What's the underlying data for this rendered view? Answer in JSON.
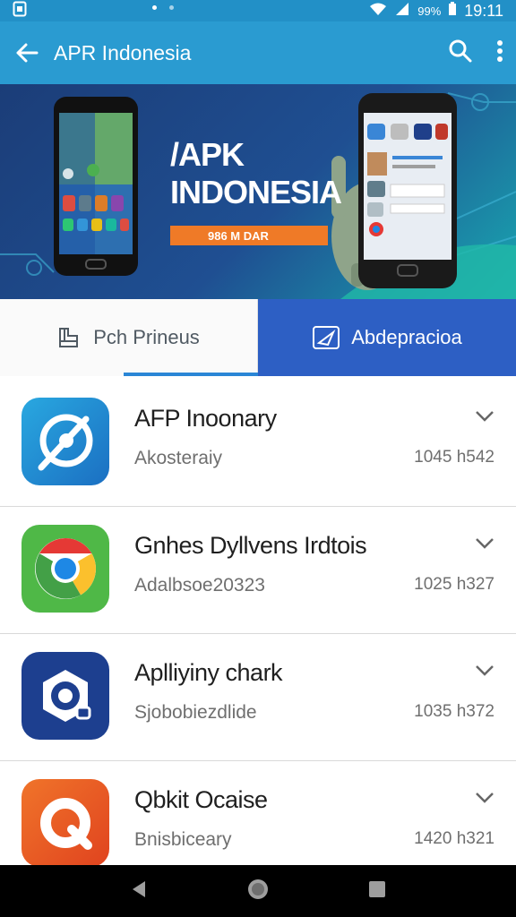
{
  "status_bar": {
    "time": "19:11",
    "battery": "99%"
  },
  "app_bar": {
    "title": "APR Indonesia"
  },
  "banner": {
    "title_line1": "/APK",
    "title_line2": "INDONESIA",
    "tagline": "986 M DAR"
  },
  "tabs": [
    {
      "label": "Pch Prineus",
      "icon": "store-icon"
    },
    {
      "label": "Abdepracioa",
      "icon": "send-icon"
    }
  ],
  "apps": [
    {
      "title": "AFP Inoonary",
      "subtitle": "Akosteraiy",
      "meta": "1045 h542",
      "icon": "compass-app-icon"
    },
    {
      "title": "Gnhes Dyllvens Irdtois",
      "subtitle": "Adalbsoe20323",
      "meta": "1025 h327",
      "icon": "chrome-app-icon"
    },
    {
      "title": "Aplliyiny chark",
      "subtitle": "Sjobobiezdlide",
      "meta": "1035 h372",
      "icon": "camera-app-icon"
    },
    {
      "title": "Qbkit Ocaise",
      "subtitle": "Bnisbiceary",
      "meta": "1420 h321",
      "icon": "q-app-icon"
    }
  ],
  "colors": {
    "status": "#2290c7",
    "app_bar": "#2a9bd1",
    "tab_active": "#2d5fc4",
    "accent_orange": "#ef7a27"
  }
}
